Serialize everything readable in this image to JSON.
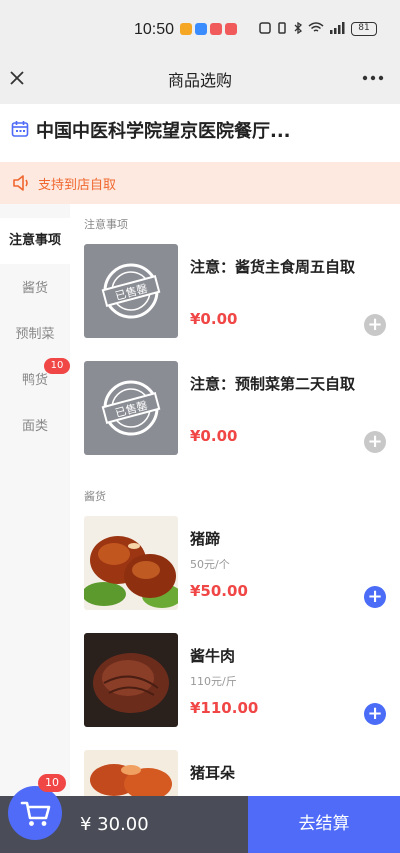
{
  "statusbar": {
    "time": "10:50",
    "battery": "81"
  },
  "navbar": {
    "close_icon": "close-icon",
    "title": "商品选购",
    "more_icon": "more-icon"
  },
  "store": {
    "name": "中国中医科学院望京医院餐厅..."
  },
  "notice": {
    "text": "支持到店自取"
  },
  "sidebar": {
    "items": [
      {
        "label": "注意事项",
        "active": true
      },
      {
        "label": "酱货"
      },
      {
        "label": "预制菜"
      },
      {
        "label": "鸭货",
        "badge": "10"
      },
      {
        "label": "面类"
      }
    ]
  },
  "sections": [
    {
      "title": "注意事项",
      "products": [
        {
          "name": "注意：酱货主食周五自取",
          "price": "¥0.00",
          "sold_out_label": "已售罄"
        },
        {
          "name": "注意：预制菜第二天自取",
          "price": "¥0.00",
          "sold_out_label": "已售罄"
        }
      ]
    },
    {
      "title": "酱货",
      "products": [
        {
          "name": "猪蹄",
          "spec": "50元/个",
          "price": "¥50.00"
        },
        {
          "name": "酱牛肉",
          "spec": "110元/斤",
          "price": "¥110.00"
        },
        {
          "name": "猪耳朵"
        }
      ]
    }
  ],
  "cart": {
    "badge": "10",
    "total": "¥ 30.00",
    "checkout_label": "去结算"
  },
  "colors": {
    "accent": "#4f6bf7",
    "price": "#f04646",
    "notice": "#f0672f",
    "cart_bar": "#4a4d57"
  }
}
